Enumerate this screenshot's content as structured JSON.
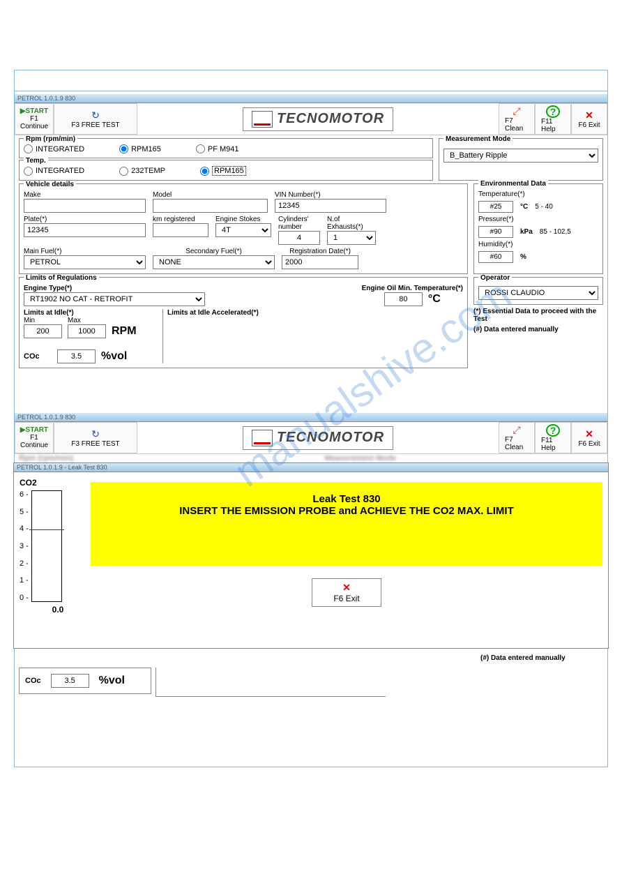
{
  "watermark": "manualshive.com",
  "titlebar1": "PETROL 1.0.1.9  830",
  "titlebar2": "PETROL 1.0.1.9  830",
  "titlebar3": "PETROL 1.0.1.9 - Leak Test  830",
  "toolbar": {
    "start": "▶START",
    "f1": "F1",
    "continue": "Continue",
    "f3": "F3 FREE TEST",
    "f7": "F7 Clean",
    "f11": "F11 Help",
    "f6": "F6 Exit"
  },
  "logo": "TECNOMOTOR",
  "rpm": {
    "legend": "Rpm (rpm/min)",
    "integrated": "INTEGRATED",
    "rpm165": "RPM165",
    "pfm941": "PF M941"
  },
  "temp": {
    "legend": "Temp.",
    "integrated": "INTEGRATED",
    "temp232": "232TEMP",
    "rpm165": "RPM165"
  },
  "mm": {
    "legend": "Measurement Mode",
    "value": "B_Battery Ripple"
  },
  "vehicle": {
    "legend": "Vehicle details",
    "make": "Make",
    "make_val": "",
    "model": "Model",
    "model_val": "",
    "vin": "VIN Number(*)",
    "vin_val": "12345",
    "plate": "Plate(*)",
    "plate_val": "12345",
    "km": "km registered",
    "km_val": "",
    "stokes": "Engine Stokes",
    "stokes_val": "4T",
    "cyl": "Cylinders' number",
    "cyl_val": "4",
    "exh": "N.of Exhausts(*)",
    "exh_val": "1",
    "mfuel": "Main Fuel(*)",
    "mfuel_val": "PETROL",
    "sfuel": "Secondary Fuel(*)",
    "sfuel_val": "NONE",
    "regdate": "Registration Date(*)",
    "regdate_val": "2000"
  },
  "env": {
    "legend": "Environmental Data",
    "temp": "Temperature(*)",
    "temp_val": "#25",
    "temp_unit": "°C",
    "temp_range": "5 - 40",
    "press": "Pressure(*)",
    "press_val": "#90",
    "press_unit": "kPa",
    "press_range": "85 - 102,5",
    "hum": "Humidity(*)",
    "hum_val": "#60",
    "hum_unit": "%"
  },
  "limits": {
    "legend": "Limits of Regulations",
    "engtype": "Engine Type(*)",
    "engtype_val": "RT1902 NO CAT - RETROFIT",
    "oiltemp": "Engine Oil Min. Temperature(*)",
    "oiltemp_val": "80",
    "oiltemp_unit": "°C",
    "idle": "Limits at Idle(*)",
    "idle_acc": "Limits at Idle Accelerated(*)",
    "min": "Min",
    "min_val": "200",
    "max": "Max",
    "max_val": "1000",
    "rpm_unit": "RPM",
    "coc": "COc",
    "coc_val": "3.5",
    "coc_unit": "%vol"
  },
  "operator": {
    "legend": "Operator",
    "value": "ROSSI CLAUDIO",
    "note1": "(*) Essential Data to proceed with the Test",
    "note2": "(#) Data entered manually"
  },
  "leak": {
    "co2": "CO2",
    "ticks": [
      "6 -",
      "5 -",
      "4 -",
      "3 -",
      "2 -",
      "1 -",
      "0 -"
    ],
    "value": "0.0",
    "title": "Leak Test 830",
    "msg": "INSERT THE EMISSION PROBE and ACHIEVE THE CO2 MAX. LIMIT",
    "exit": "F6 Exit"
  },
  "chart_data": {
    "type": "bar",
    "categories": [
      "CO2"
    ],
    "values": [
      0.0
    ],
    "ylim": [
      0,
      6
    ],
    "threshold": 4,
    "title": "CO2",
    "ylabel": "",
    "xlabel": ""
  }
}
